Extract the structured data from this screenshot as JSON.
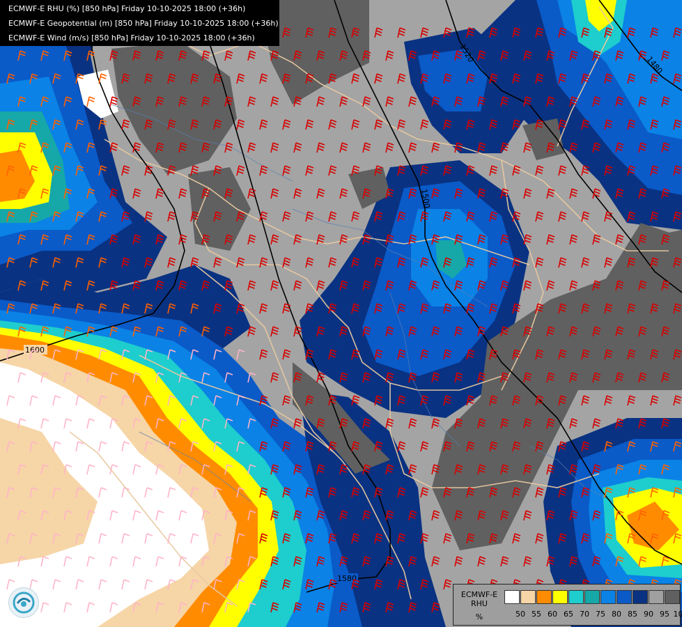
{
  "titles": {
    "line1": "ECMWF-E RHU (%) [850 hPa] Friday 10-10-2025 18:00 (+36h)",
    "line2": "ECMWF-E Geopotential (m) [850 hPa] Friday 10-10-2025 18:00 (+36h)",
    "line3": "ECMWF-E Wind (m/s) [850 hPa] Friday 10-10-2025 18:00 (+36h)"
  },
  "legend": {
    "title_line1": "ECMWF-E",
    "title_line2": "RHU",
    "unit": "%",
    "ticks": [
      "50",
      "55",
      "60",
      "65",
      "70",
      "75",
      "80",
      "85",
      "90",
      "95",
      "100"
    ],
    "colors": [
      "#ffffff",
      "#f6d5a7",
      "#ff8c00",
      "#ffff00",
      "#1ecdcd",
      "#16a8a8",
      "#0a82e6",
      "#0a5ac8",
      "#0a3282",
      "#a0a0a0",
      "#606060"
    ]
  },
  "contours": {
    "labels": [
      "1600",
      "1580",
      "1560",
      "1520",
      "1500",
      "1480"
    ]
  },
  "colors": {
    "dry": "#f6d5a7",
    "orange": "#ff8c00",
    "yellow": "#ffff00",
    "cyan": "#1ecdcd",
    "teal": "#16a8a8",
    "blue_light": "#0a82e6",
    "blue_mid": "#0a5ac8",
    "navy": "#0a3282",
    "gray": "#a0a0a0",
    "dark_gray": "#606060",
    "barb_red": "#d80000",
    "barb_orange": "#ff6000",
    "barb_pink": "#ffb4c8",
    "border": "#e8c9a0"
  }
}
